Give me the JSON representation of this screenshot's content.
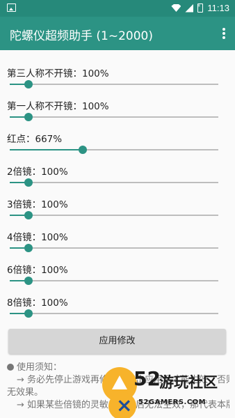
{
  "status_bar": {
    "time": "11:13"
  },
  "app_bar": {
    "title": "陀螺仪超频助手 (1~2000)"
  },
  "settings": [
    {
      "label": "第三人称不开镜：100%",
      "value": 100
    },
    {
      "label": "第一人称不开镜：100%",
      "value": 100
    },
    {
      "label": "红点：667%",
      "value": 667
    },
    {
      "label": "2倍镜：100%",
      "value": 100
    },
    {
      "label": "3倍镜：100%",
      "value": 100
    },
    {
      "label": "4倍镜：100%",
      "value": 100
    },
    {
      "label": "6倍镜：100%",
      "value": 100
    },
    {
      "label": "8倍镜：100%",
      "value": 100
    }
  ],
  "slider_range": {
    "min": 1,
    "max": 2000
  },
  "apply_button": {
    "label": "应用修改"
  },
  "notes": {
    "heading": "使用须知：",
    "lines": [
      "→ 务必先停止游戏再修改，点击应用后才能生效，否则无效果。",
      "→ 如果某些倍镜的灵敏度修改后无法生效，那代表本版本无法修改"
    ]
  },
  "watermark": {
    "number": "52",
    "text": "游玩社区",
    "domain": "52GAMERS.COM"
  },
  "colors": {
    "primary": "#2c9384",
    "status_bar": "#26897a",
    "button": "#d6d6d6"
  }
}
